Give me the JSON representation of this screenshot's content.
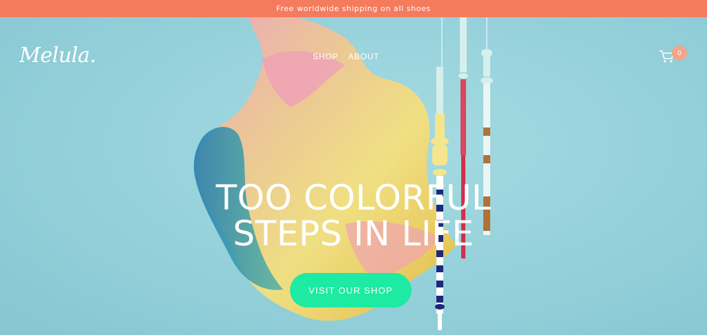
{
  "announcement": {
    "text": "Free worldwide shipping on all shoes"
  },
  "header": {
    "logo": "Melula.",
    "nav": [
      {
        "label": "SHOP"
      },
      {
        "label": "ABOUT"
      }
    ],
    "cart_count": "0"
  },
  "hero": {
    "headline_line1": "TOO COLORFUL",
    "headline_line2": "STEPS IN LIFE",
    "cta_label": "VISIT OUR SHOP"
  },
  "colors": {
    "announcement_bg": "#f47b5e",
    "hero_bg": "#94d0da",
    "cta_bg": "#1deaa3",
    "badge_bg": "#f2a58a"
  },
  "icons": [
    "cart-icon"
  ]
}
